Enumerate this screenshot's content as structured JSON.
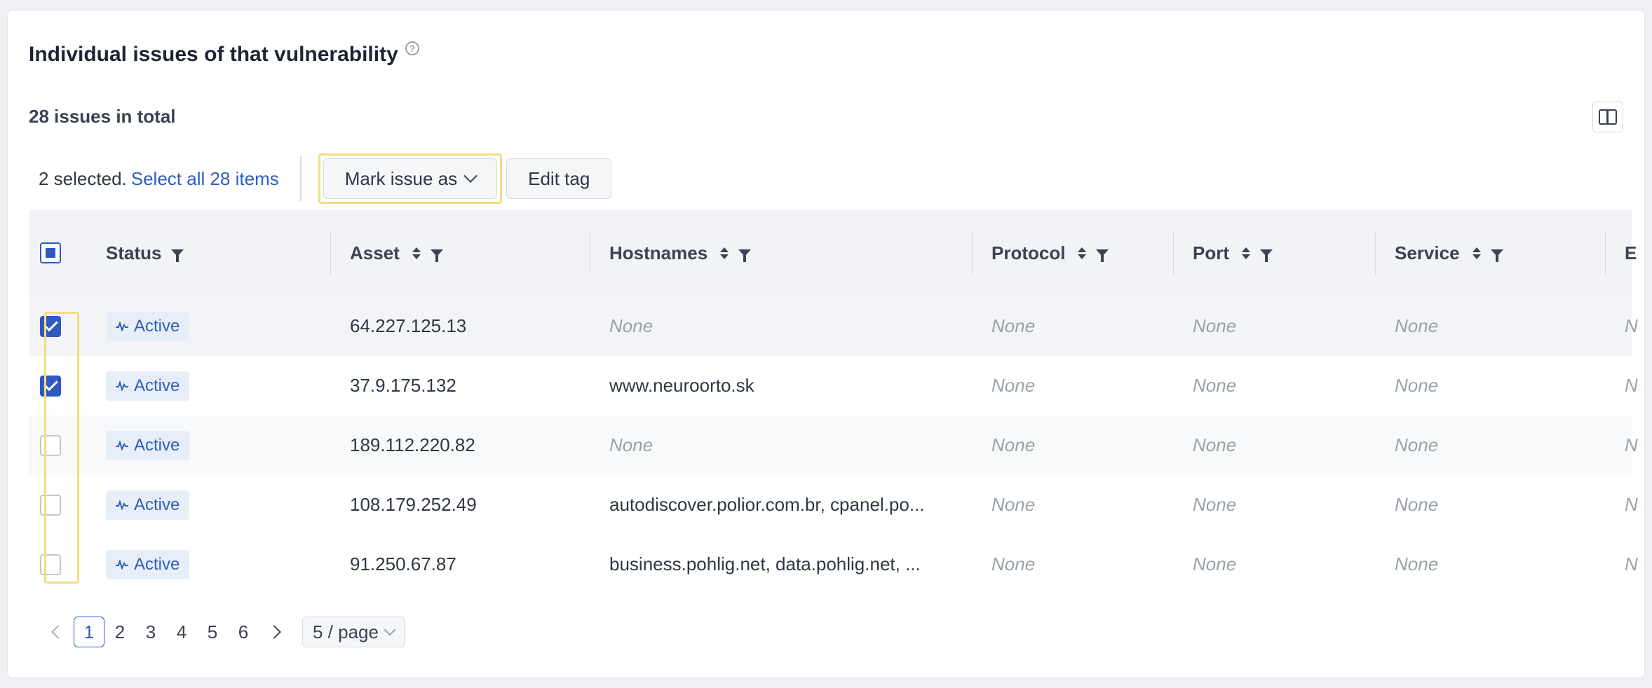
{
  "section": {
    "title": "Individual issues of that vulnerability",
    "total": "28 issues in total"
  },
  "toolbar": {
    "selected_text": "2 selected.",
    "select_all_link": "Select all 28 items",
    "mark_issue_label": "Mark issue as",
    "edit_tag_label": "Edit tag"
  },
  "table": {
    "columns": [
      "Status",
      "Asset",
      "Hostnames",
      "Protocol",
      "Port",
      "Service",
      "E"
    ],
    "rows": [
      {
        "checked": true,
        "status": "Active",
        "asset": "64.227.125.13",
        "hostnames": "None",
        "protocol": "None",
        "port": "None",
        "service": "None",
        "extra": "N"
      },
      {
        "checked": true,
        "status": "Active",
        "asset": "37.9.175.132",
        "hostnames": "www.neuroorto.sk",
        "protocol": "None",
        "port": "None",
        "service": "None",
        "extra": "N"
      },
      {
        "checked": false,
        "status": "Active",
        "asset": "189.112.220.82",
        "hostnames": "None",
        "protocol": "None",
        "port": "None",
        "service": "None",
        "extra": "N"
      },
      {
        "checked": false,
        "status": "Active",
        "asset": "108.179.252.49",
        "hostnames": "autodiscover.polior.com.br, cpanel.po...",
        "protocol": "None",
        "port": "None",
        "service": "None",
        "extra": "N"
      },
      {
        "checked": false,
        "status": "Active",
        "asset": "91.250.67.87",
        "hostnames": "business.pohlig.net, data.pohlig.net, ...",
        "protocol": "None",
        "port": "None",
        "service": "None",
        "extra": "N"
      }
    ]
  },
  "pagination": {
    "pages": [
      "1",
      "2",
      "3",
      "4",
      "5",
      "6"
    ],
    "current": "1",
    "page_size": "5 / page"
  },
  "colors": {
    "accent": "#2f59c0",
    "highlight": "#f5dc7e",
    "badge_bg": "#e8eef8"
  }
}
